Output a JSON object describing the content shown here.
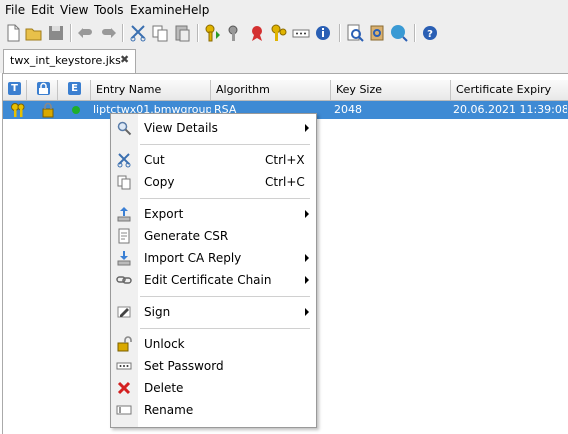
{
  "menubar": {
    "items": [
      "File",
      "Edit",
      "View",
      "Tools",
      "Examine",
      "Help"
    ]
  },
  "tab": {
    "label": "twx_int_keystore.jks"
  },
  "table": {
    "icon_headers": [
      "T",
      "E"
    ],
    "columns": [
      "Entry Name",
      "Algorithm",
      "Key Size",
      "Certificate Expiry"
    ],
    "row": {
      "entry_name": "liptctwx01.bmwgroup...",
      "algorithm": "RSA",
      "key_size": "2048",
      "expiry": "20.06.2021 11:39:08 ..."
    }
  },
  "context_menu": {
    "view_details": "View Details",
    "cut": "Cut",
    "cut_shortcut": "Ctrl+X",
    "copy": "Copy",
    "copy_shortcut": "Ctrl+C",
    "export": "Export",
    "generate_csr": "Generate CSR",
    "import_ca_reply": "Import CA Reply",
    "edit_chain": "Edit Certificate Chain",
    "sign": "Sign",
    "unlock": "Unlock",
    "set_password": "Set Password",
    "delete": "Delete",
    "rename": "Rename"
  },
  "colors": {
    "selection": "#3e8ad4",
    "header_t": "#3b7fd0",
    "header_e": "#3b7fd0",
    "status_ok": "#1fae2a"
  }
}
